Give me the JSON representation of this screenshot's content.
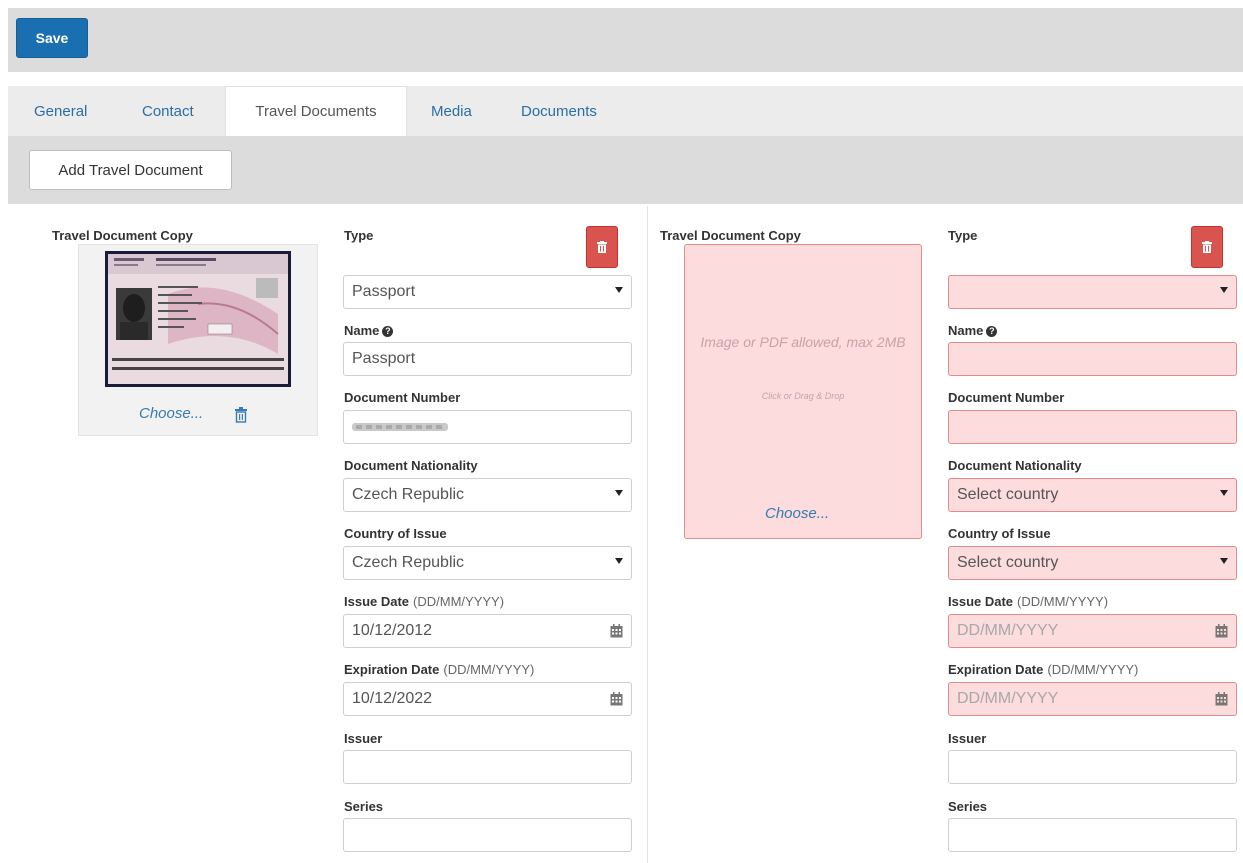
{
  "toolbar": {
    "save_label": "Save"
  },
  "tabs": [
    "General",
    "Contact",
    "Travel Documents",
    "Media",
    "Documents"
  ],
  "add_button_label": "Add Travel Document",
  "labels": {
    "copy": "Travel Document Copy",
    "type": "Type",
    "name": "Name",
    "doc_number": "Document Number",
    "nationality": "Document Nationality",
    "country_issue": "Country of Issue",
    "issue_date": "Issue Date",
    "expiration_date": "Expiration Date",
    "date_format": "(DD/MM/YYYY)",
    "issuer": "Issuer",
    "series": "Series"
  },
  "doc1": {
    "choose": "Choose...",
    "type_value": "Passport",
    "name_value": "Passport",
    "doc_number_value": "",
    "nationality_value": "Czech Republic",
    "country_issue_value": "Czech Republic",
    "issue_date_value": "10/12/2012",
    "expiration_date_value": "10/12/2022",
    "issuer_value": "",
    "series_value": ""
  },
  "doc2": {
    "drop_hint_main": "Image or PDF allowed, max 2MB",
    "drop_hint_sub": "Click or Drag & Drop",
    "choose": "Choose...",
    "type_value": "",
    "name_value": "",
    "doc_number_value": "",
    "nationality_placeholder": "Select country",
    "country_issue_placeholder": "Select country",
    "date_placeholder": "DD/MM/YYYY",
    "issuer_value": "",
    "series_value": ""
  },
  "colors": {
    "primary": "#1a6fb0",
    "danger": "#d9534f",
    "error_bg": "#fcdcdc",
    "link": "#3a7ab3"
  }
}
